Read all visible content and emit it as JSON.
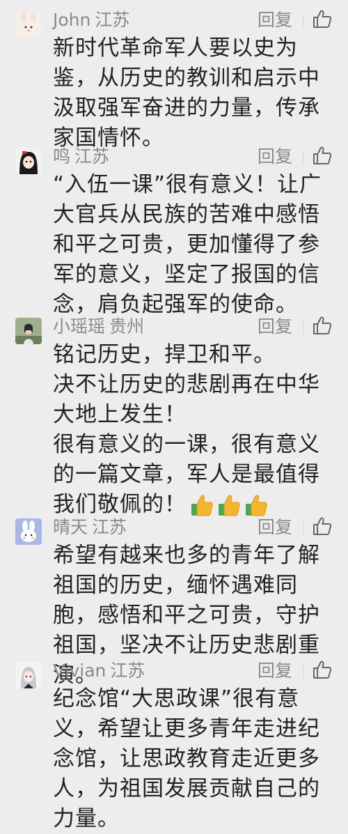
{
  "labels": {
    "reply": "回复"
  },
  "icons": {
    "like": "thumbs-up-outline-icon",
    "emoji": "thumbs-up-emoji-icon"
  },
  "comments": [
    {
      "name": "John",
      "location": "江苏",
      "avatar": "cartoon-bunny-avatar",
      "text": "新时代革命军人要以史为鉴，从历史的教训和启示中汲取强军奋进的力量，传承家国情怀。"
    },
    {
      "name": "鸣",
      "location": "江苏",
      "avatar": "anime-girl-avatar",
      "text": "“入伍一课”很有意义！让广大官兵从民族的苦难中感悟和平之可贵，更加懂得了参军的意义，坚定了报国的信念，肩负起强军的使命。"
    },
    {
      "name": "小瑶瑶",
      "location": "贵州",
      "avatar": "photo-avatar",
      "text": "铭记历史，捍卫和平。\n决不让历史的悲剧再在中华大地上发生！\n很有意义的一课，很有意义的一篇文章，军人是最值得我们敬佩的！",
      "emoji_count": 3
    },
    {
      "name": "晴天",
      "location": "江苏",
      "avatar": "cartoon-rabbit-avatar",
      "text": "希望有越来也多的青年了解祖国的历史，缅怀遇难同胞，感悟和平之可贵，守护祖国，坚决不让历史悲剧重演。"
    },
    {
      "name": "Vivian",
      "location": "江苏",
      "avatar": "anime-girl-avatar",
      "text": "纪念馆“大思政课”很有意义，希望让更多青年走进纪念馆，让思政教育走近更多人，为祖国发展贡献自己的力量。"
    }
  ]
}
